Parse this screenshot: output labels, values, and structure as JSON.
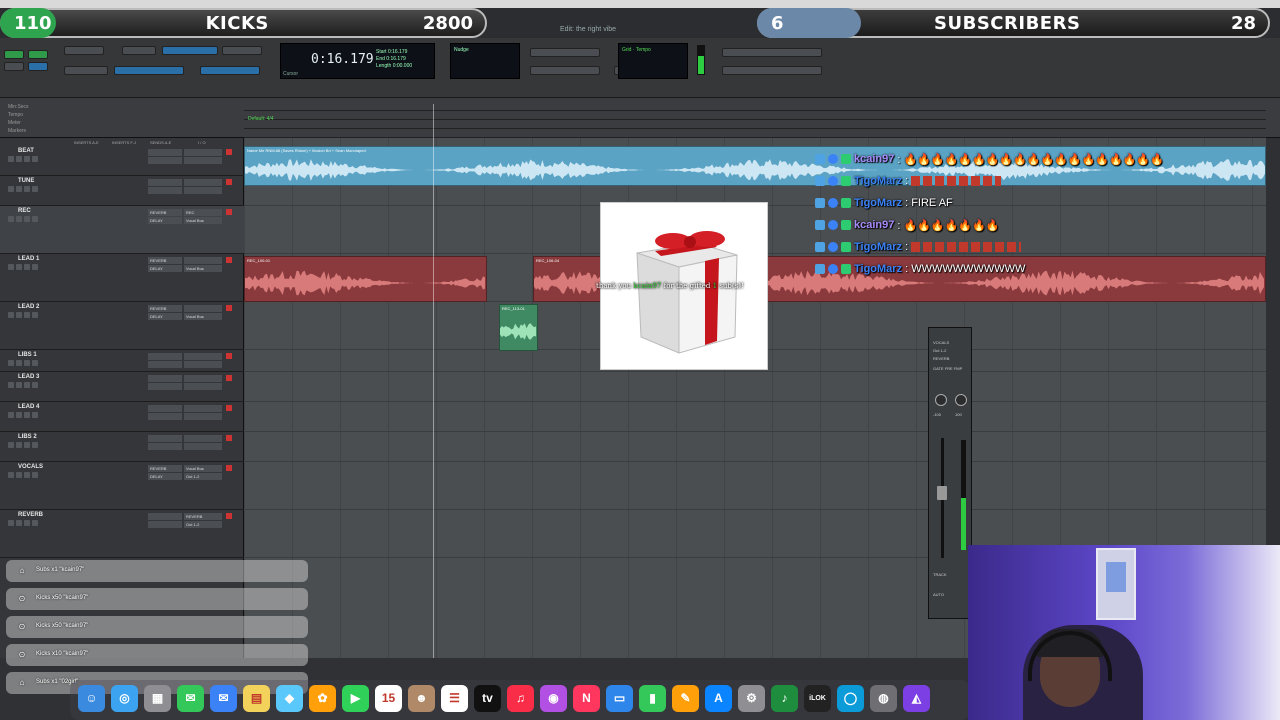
{
  "overlay": {
    "kicks_count": "110",
    "kicks_label": "KICKS",
    "kicks_goal": "2800",
    "subs_count": "6",
    "subs_label": "SUBSCRIBERS",
    "subs_goal": "28"
  },
  "window": {
    "title": "Edit: the right vibe"
  },
  "transport": {
    "counter": "0:16.179",
    "counter_label": "Cursor",
    "side_labels": [
      "Start",
      "End",
      "Length"
    ],
    "side_values": [
      "0:16.179",
      "0:16.179",
      "0:00.000"
    ],
    "nudge_label": "Nudge",
    "grid_label": "Grid",
    "tempo_label": "Tempo"
  },
  "rulers": [
    "Min:Secs",
    "Tempo",
    "Meter",
    "Markers"
  ],
  "tempo_marker": "Default: 4/4",
  "column_captions": [
    "INSERTS A-E",
    "INSERTS F-J",
    "SENDS A-E",
    "I / O"
  ],
  "tracks": [
    {
      "name": "BEAT",
      "sends": [
        "",
        ""
      ],
      "ins": [
        "",
        ""
      ]
    },
    {
      "name": "TUNE",
      "sends": [
        "",
        ""
      ],
      "ins": [
        "",
        ""
      ]
    },
    {
      "name": "REC",
      "sends": [
        "REVERB",
        "DELAY"
      ],
      "ins": [
        "REC",
        "Vocal Bus"
      ]
    },
    {
      "name": "LEAD 1",
      "sends": [
        "REVERB",
        "DELAY"
      ],
      "ins": [
        "",
        "Vocal Bus"
      ]
    },
    {
      "name": "LEAD 2",
      "sends": [
        "REVERB",
        "DELAY"
      ],
      "ins": [
        "",
        "Vocal Bus"
      ]
    },
    {
      "name": "LIBS 1",
      "sends": [
        "",
        ""
      ],
      "ins": [
        "",
        ""
      ]
    },
    {
      "name": "LEAD 3",
      "sends": [
        "",
        ""
      ],
      "ins": [
        "",
        ""
      ]
    },
    {
      "name": "LEAD 4",
      "sends": [
        "",
        ""
      ],
      "ins": [
        "",
        ""
      ]
    },
    {
      "name": "LIBS 2",
      "sends": [
        "",
        ""
      ],
      "ins": [
        "",
        ""
      ]
    },
    {
      "name": "VOCALS",
      "sends": [
        "REVERB",
        "DELAY"
      ],
      "ins": [
        "Vocal Bus",
        "Out 1-2"
      ]
    },
    {
      "name": "REVERB",
      "sends": [
        "",
        ""
      ],
      "ins": [
        "REVERB",
        "Out 1-2"
      ]
    }
  ],
  "clips": [
    {
      "label": "Name Me RNM.88 (Saves Ridom) + Illusion Bri + Sean Monotaped"
    },
    {
      "label": "REC_100-01"
    },
    {
      "label": "REC_106-04"
    },
    {
      "label": "REC_113-01"
    }
  ],
  "chat": [
    {
      "user": "kcain97",
      "msg": "🔥🔥🔥🔥🔥🔥🔥🔥🔥🔥🔥🔥🔥🔥🔥🔥🔥🔥🔥"
    },
    {
      "user": "TigoMarz",
      "msg": ""
    },
    {
      "user": "TigoMarz",
      "msg": "FIRE AF"
    },
    {
      "user": "kcain97",
      "msg": "🔥🔥🔥🔥🔥🔥🔥"
    },
    {
      "user": "TigoMarz",
      "msg": ""
    },
    {
      "user": "TigoMarz",
      "msg": "WWWWWWWWWWW"
    }
  ],
  "gift": {
    "text_a": "thank you ",
    "user": "kcain97",
    "text_b": " for the gifted ",
    "count": "1",
    "text_c": " sub(s)!"
  },
  "mixer": {
    "labels": [
      "VOCALS",
      "Out 1-2",
      "REVERB",
      "GATE FRE FMP"
    ],
    "pan": [
      "-100",
      "100"
    ],
    "bottom": [
      "TRACK",
      "AUTO"
    ]
  },
  "notifications": [
    {
      "text": "Subs x1 \"kcain97\"",
      "icon": "bell-icon"
    },
    {
      "text": "Kicks x50 \"kcain97\"",
      "icon": "kick-icon"
    },
    {
      "text": "Kicks x50 \"kcain97\"",
      "icon": "kick-icon"
    },
    {
      "text": "Kicks x10 \"kcain97\"",
      "icon": "kick-icon"
    },
    {
      "text": "Subs x1 \"02girl\"",
      "icon": "bell-icon"
    }
  ],
  "dock": [
    {
      "name": "finder",
      "color": "#3a8be0",
      "glyph": "☺"
    },
    {
      "name": "safari",
      "color": "#3ba3f0",
      "glyph": "◎"
    },
    {
      "name": "launchpad",
      "color": "#8e8e93",
      "glyph": "▦"
    },
    {
      "name": "messages",
      "color": "#34c759",
      "glyph": "✉"
    },
    {
      "name": "mail",
      "color": "#3b82f6",
      "glyph": "✉"
    },
    {
      "name": "notes",
      "color": "#f2d25a",
      "glyph": "▤"
    },
    {
      "name": "maps",
      "color": "#5ac8fa",
      "glyph": "◆"
    },
    {
      "name": "photos",
      "color": "#ff9f0a",
      "glyph": "✿"
    },
    {
      "name": "facetime",
      "color": "#30d158",
      "glyph": "▶"
    },
    {
      "name": "calendar",
      "color": "#ffffff",
      "glyph": "15"
    },
    {
      "name": "contacts",
      "color": "#b08968",
      "glyph": "☻"
    },
    {
      "name": "reminders",
      "color": "#ffffff",
      "glyph": "☰"
    },
    {
      "name": "tv",
      "color": "#111111",
      "glyph": "tv"
    },
    {
      "name": "music",
      "color": "#fa2d48",
      "glyph": "♫"
    },
    {
      "name": "podcasts",
      "color": "#b150e2",
      "glyph": "◉"
    },
    {
      "name": "news",
      "color": "#ff375f",
      "glyph": "N"
    },
    {
      "name": "keynote",
      "color": "#2f86ea",
      "glyph": "▭"
    },
    {
      "name": "numbers",
      "color": "#34c759",
      "glyph": "▮"
    },
    {
      "name": "pages",
      "color": "#ff9f0a",
      "glyph": "✎"
    },
    {
      "name": "app-store",
      "color": "#0a84ff",
      "glyph": "A"
    },
    {
      "name": "system-settings",
      "color": "#8e8e93",
      "glyph": "⚙"
    },
    {
      "name": "pro-tools",
      "color": "#1e8e3e",
      "glyph": "♪"
    },
    {
      "name": "ilok",
      "color": "#222222",
      "glyph": "iLOK"
    },
    {
      "name": "obs",
      "color": "#0a9bd8",
      "glyph": "◯"
    },
    {
      "name": "utility",
      "color": "#6e6e73",
      "glyph": "◍"
    },
    {
      "name": "recorder",
      "color": "#7b3fe4",
      "glyph": "◭"
    }
  ]
}
